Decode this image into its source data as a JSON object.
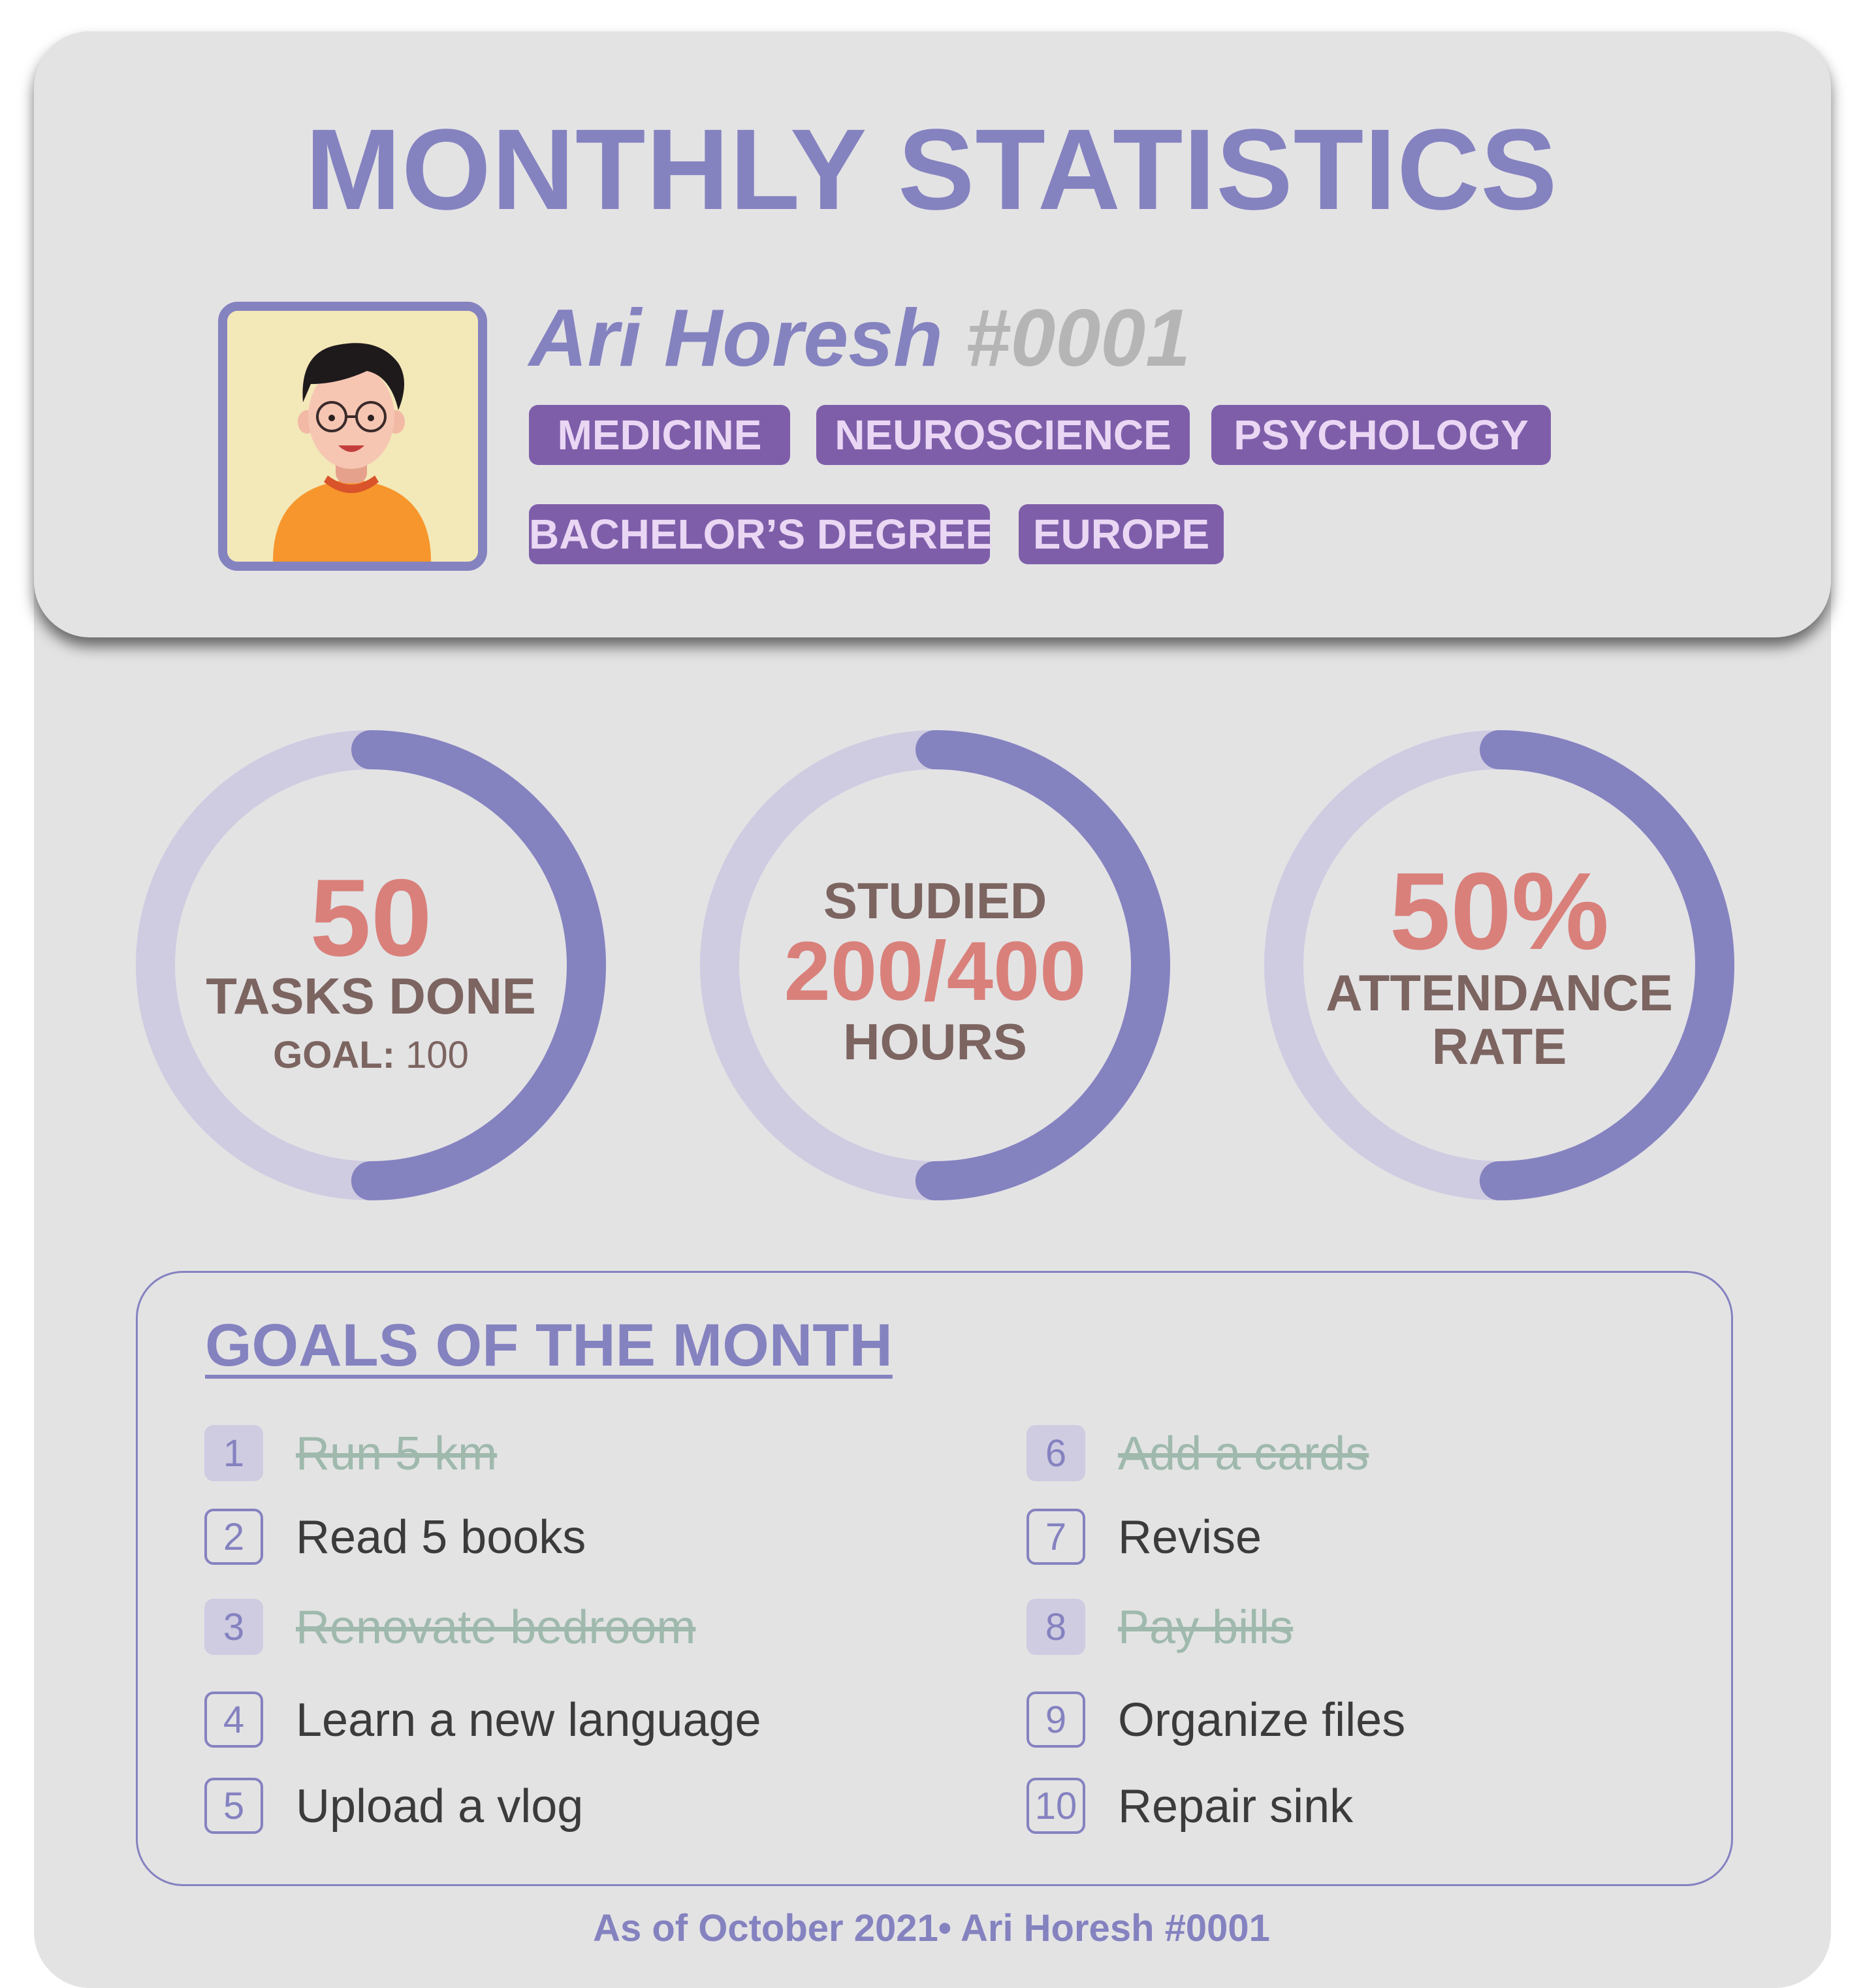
{
  "title": "MONTHLY STATISTICS",
  "profile": {
    "name": "Ari Horesh",
    "id": "#0001",
    "tags": [
      "MEDICINE",
      "NEUROSCIENCE",
      "PSYCHOLOGY",
      "BACHELOR’S DEGREE",
      "EUROPE"
    ]
  },
  "stats": [
    {
      "value": "50",
      "label": "TASKS DONE",
      "goal_label": "GOAL:",
      "goal_value": "100",
      "progress": 0.5
    },
    {
      "top_label": "STUDIED",
      "value": "200/400",
      "label": "HOURS",
      "progress": 0.5
    },
    {
      "value": "50%",
      "label_line1": "ATTENDANCE",
      "label_line2": "RATE",
      "progress": 0.5
    }
  ],
  "goals": {
    "title": "GOALS OF THE MONTH",
    "items": [
      {
        "num": "1",
        "text": "Run 5 km",
        "done": true
      },
      {
        "num": "2",
        "text": "Read 5 books",
        "done": false
      },
      {
        "num": "3",
        "text": "Renovate bedroom",
        "done": true
      },
      {
        "num": "4",
        "text": "Learn a new language",
        "done": false
      },
      {
        "num": "5",
        "text": "Upload a vlog",
        "done": false
      },
      {
        "num": "6",
        "text": "Add a cards",
        "done": true
      },
      {
        "num": "7",
        "text": "Revise",
        "done": false
      },
      {
        "num": "8",
        "text": "Pay bills",
        "done": true
      },
      {
        "num": "9",
        "text": "Organize files",
        "done": false
      },
      {
        "num": "10",
        "text": "Repair sink",
        "done": false
      }
    ]
  },
  "footer": "As of October 2021• Ari Horesh #0001",
  "colors": {
    "accent": "#8582c0",
    "tag_bg": "#7e5ea9",
    "highlight": "#d9807b",
    "label": "#7c6460",
    "done_text": "#9fb9ad"
  }
}
